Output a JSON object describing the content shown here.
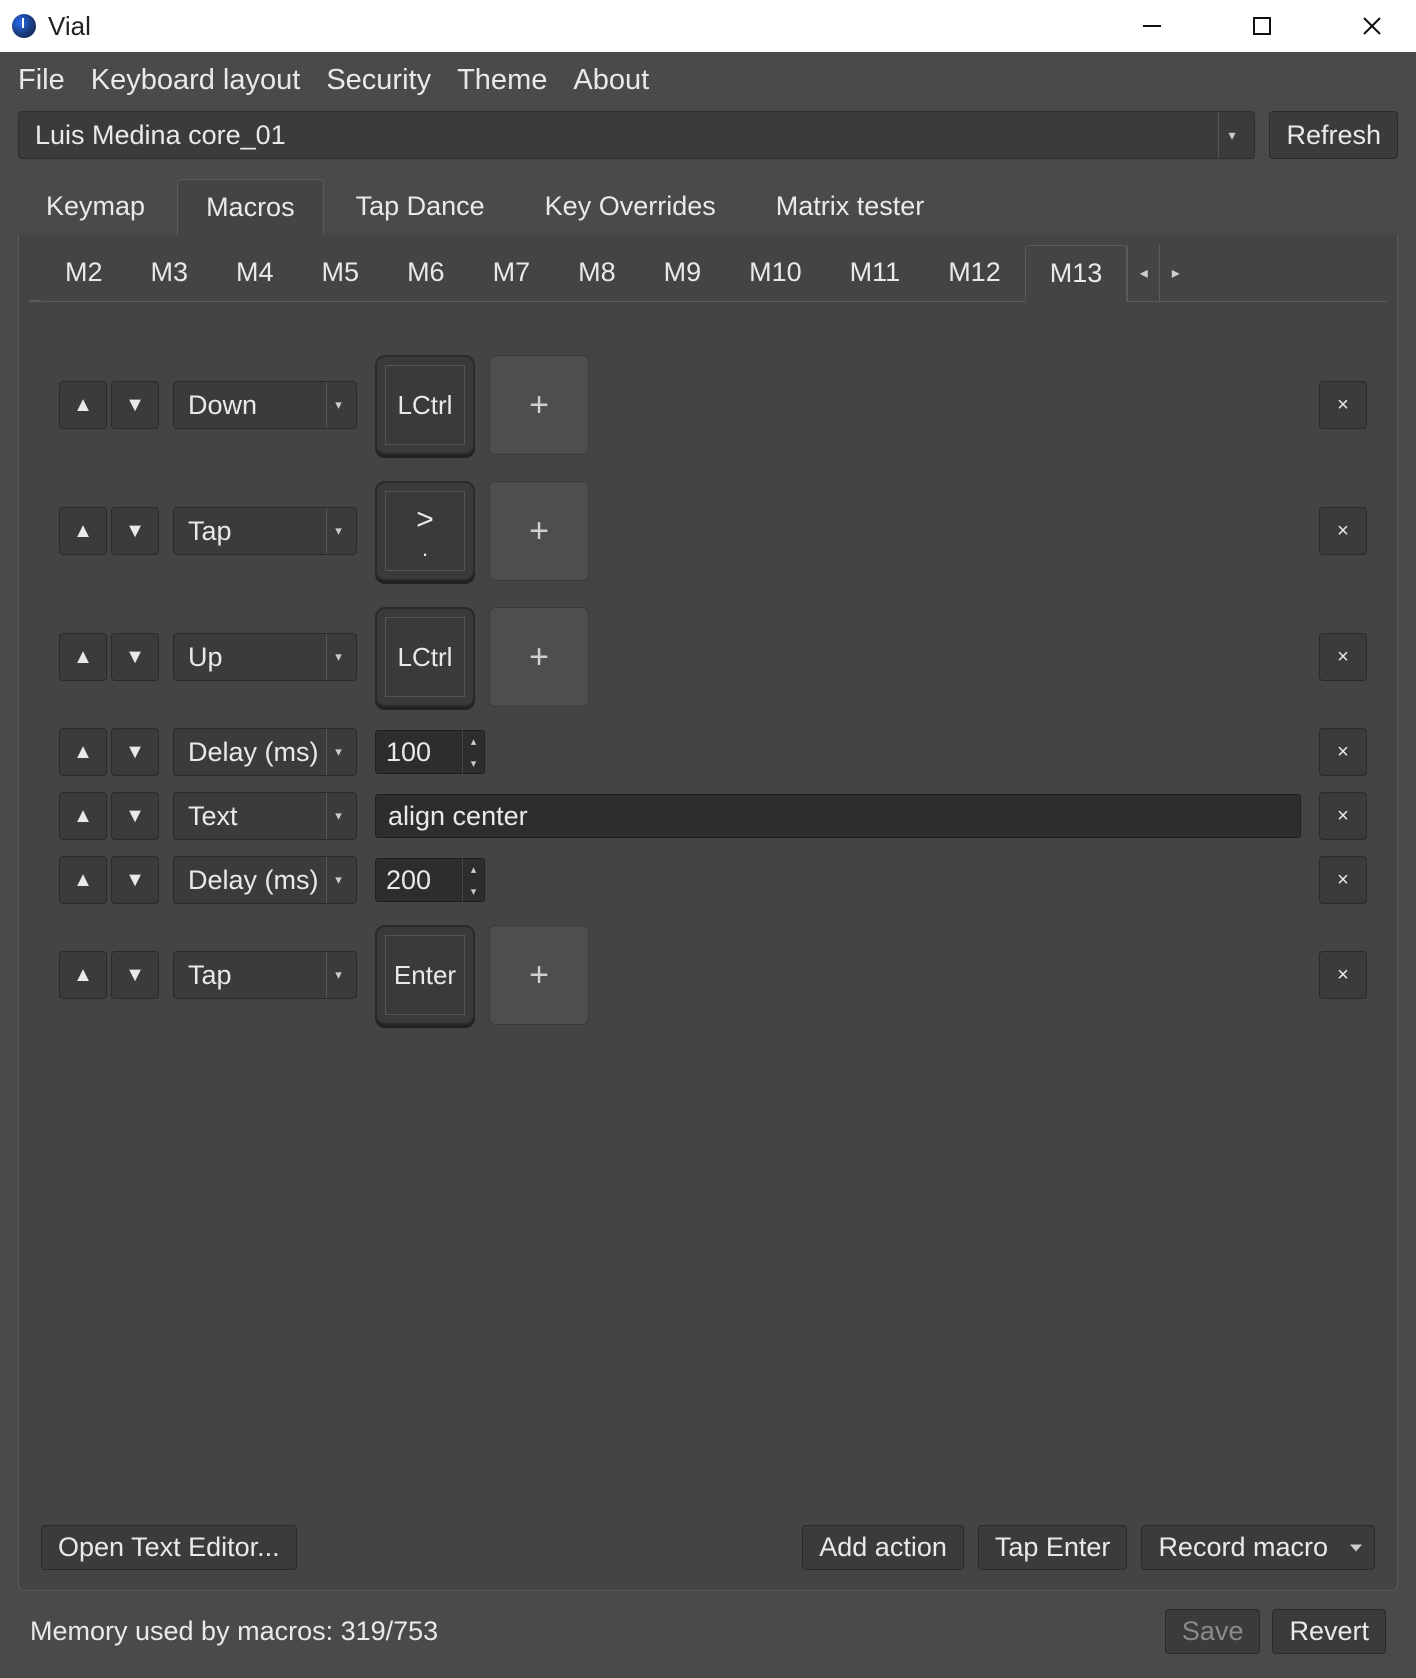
{
  "window": {
    "title": "Vial"
  },
  "menu": [
    "File",
    "Keyboard layout",
    "Security",
    "Theme",
    "About"
  ],
  "device": {
    "name": "Luis Medina core_01"
  },
  "buttons": {
    "refresh": "Refresh",
    "open_text_editor": "Open Text Editor...",
    "add_action": "Add action",
    "tap_enter": "Tap Enter",
    "record_macro": "Record macro",
    "save": "Save",
    "revert": "Revert"
  },
  "tabs": {
    "items": [
      "Keymap",
      "Macros",
      "Tap Dance",
      "Key Overrides",
      "Matrix tester"
    ],
    "active_index": 1
  },
  "macro_tabs": {
    "items": [
      "M2",
      "M3",
      "M4",
      "M5",
      "M6",
      "M7",
      "M8",
      "M9",
      "M10",
      "M11",
      "M12",
      "M13"
    ],
    "active_index": 11
  },
  "rows": [
    {
      "type": "key",
      "action": "Down",
      "keys": [
        {
          "top": "",
          "bottom": "LCtrl"
        }
      ]
    },
    {
      "type": "key",
      "action": "Tap",
      "keys": [
        {
          "top": ">",
          "bottom": "."
        }
      ]
    },
    {
      "type": "key",
      "action": "Up",
      "keys": [
        {
          "top": "",
          "bottom": "LCtrl"
        }
      ]
    },
    {
      "type": "delay",
      "action": "Delay (ms)",
      "value": "100"
    },
    {
      "type": "text",
      "action": "Text",
      "value": "align center"
    },
    {
      "type": "delay",
      "action": "Delay (ms)",
      "value": "200"
    },
    {
      "type": "key",
      "action": "Tap",
      "keys": [
        {
          "top": "",
          "bottom": "Enter"
        }
      ]
    }
  ],
  "status": {
    "memory": "Memory used by macros: 319/753"
  },
  "glyphs": {
    "up_triangle": "▲",
    "down_triangle": "▼",
    "times": "×",
    "plus": "+",
    "small_left": "◂",
    "small_right": "▸",
    "dd_arrow": "▾",
    "spin_up": "▴",
    "spin_down": "▾"
  }
}
